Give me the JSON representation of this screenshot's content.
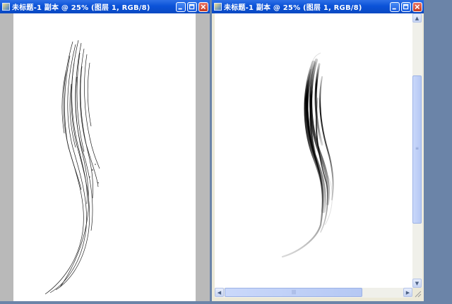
{
  "windows": [
    {
      "title": "未标题-1 副本 @ 25% (图层 1, RGB/8)",
      "view": "outline strokes"
    },
    {
      "title": "未标题-1 副本 @ 25% (图层 1, RGB/8)",
      "view": "filled strokes"
    }
  ],
  "icons": {
    "app": "photoshop-doc-icon",
    "minimize": "minimize-icon",
    "maximize": "maximize-icon",
    "close": "close-icon",
    "scroll_up": "scroll-up-arrow-icon",
    "scroll_down": "scroll-down-arrow-icon",
    "scroll_left": "scroll-left-arrow-icon",
    "scroll_right": "scroll-right-arrow-icon",
    "resize_grip": "resize-grip-icon"
  },
  "colors": {
    "title_bar": "#0b52d8",
    "close_button": "#c53a1f",
    "workspace_gray": "#b9b9b9",
    "desktop": "#6b84a8"
  }
}
